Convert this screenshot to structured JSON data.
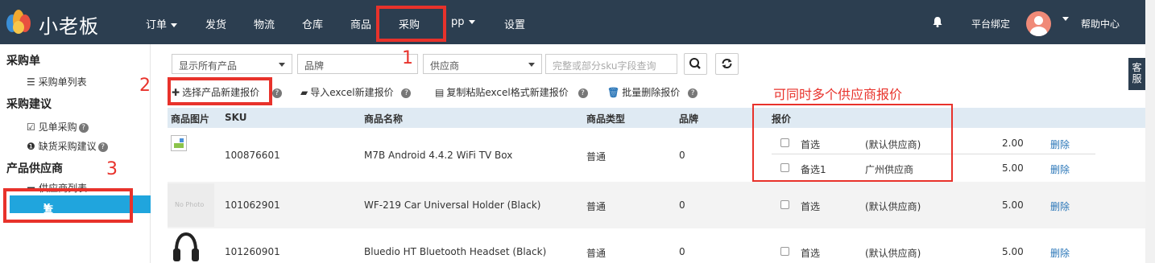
{
  "brand": {
    "name": "小老板"
  },
  "nav": {
    "items": [
      {
        "label": "订单",
        "has_caret": true
      },
      {
        "label": "发货"
      },
      {
        "label": "物流"
      },
      {
        "label": "仓库"
      },
      {
        "label": "商品"
      },
      {
        "label": "采购"
      },
      {
        "label": "pp",
        "has_caret": true
      },
      {
        "label": "设置"
      }
    ],
    "right": {
      "platform_bind": "平台绑定",
      "help": "帮助中心"
    }
  },
  "sidebar": {
    "sections": [
      {
        "title": "采购单",
        "items": [
          {
            "label": "采购单列表",
            "icon": "list-icon"
          }
        ]
      },
      {
        "title": "采购建议",
        "items": [
          {
            "label": "见单采购",
            "icon": "edit-icon",
            "help": "?"
          },
          {
            "label": "缺货采购建议",
            "icon": "info-icon",
            "help": "?"
          }
        ]
      },
      {
        "title": "产品供应商",
        "items": [
          {
            "label": "供应商列表",
            "icon": "truck-icon"
          },
          {
            "label": "查看报价",
            "icon": "yen-icon",
            "active": true
          }
        ]
      }
    ]
  },
  "filters": {
    "product_select": "显示所有产品",
    "brand_select": "品牌",
    "supplier_select": "供应商",
    "sku_placeholder": "完整或部分sku字段查询"
  },
  "actions": {
    "new_quote": "选择产品新建报价",
    "import_excel": "导入excel新建报价",
    "paste_excel": "复制粘贴excel格式新建报价",
    "batch_delete": "批量删除报价"
  },
  "table": {
    "headers": [
      "商品图片",
      "SKU",
      "商品名称",
      "商品类型",
      "品牌",
      "报价"
    ],
    "rows": [
      {
        "image": "broken",
        "sku": "100876601",
        "name": "M7B Android 4.4.2 WiFi TV Box",
        "type": "普通",
        "brand": "0",
        "quotes": [
          {
            "tag": "首选",
            "supplier": "(默认供应商)",
            "price": "2.00",
            "action": "删除"
          },
          {
            "tag": "备选1",
            "supplier": "广州供应商",
            "price": "5.00",
            "action": "删除"
          }
        ]
      },
      {
        "image": "No Photo",
        "sku": "101062901",
        "name": "WF-219 Car Universal Holder (Black)",
        "type": "普通",
        "brand": "0",
        "quotes": [
          {
            "tag": "首选",
            "supplier": "(默认供应商)",
            "price": "5.00",
            "action": "删除"
          }
        ]
      },
      {
        "image": "headphones",
        "sku": "101260901",
        "name": "Bluedio HT Bluetooth Headset (Black)",
        "type": "普通",
        "brand": "0",
        "quotes": [
          {
            "tag": "首选",
            "supplier": "(默认供应商)",
            "price": "5.00",
            "action": "删除"
          }
        ]
      }
    ]
  },
  "annotations": {
    "step1": "1",
    "step2": "2",
    "step3": "3",
    "note": "可同时多个供应商报价",
    "color": "#e8322b"
  },
  "chat_widget": {
    "label": "客服"
  },
  "colors": {
    "topbar": "#2c3e50",
    "accent": "#20a5dd",
    "link": "#2a76b8"
  }
}
